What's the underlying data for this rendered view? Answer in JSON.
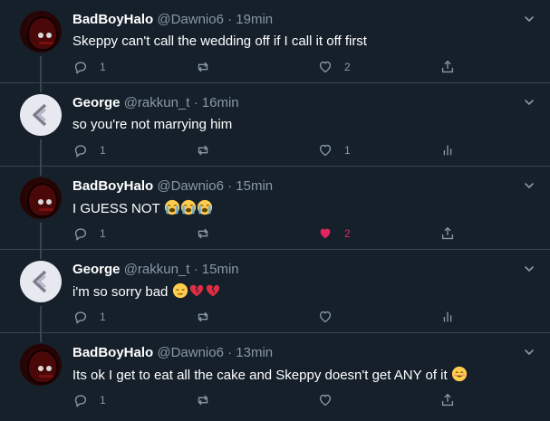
{
  "tweets": [
    {
      "name": "BadBoyHalo",
      "handle": "@Dawnio6",
      "dot": "·",
      "time": "19min",
      "text": "Skeppy can't call the wedding off if I call it off first",
      "emoji": [],
      "replies": "1",
      "retweets": "",
      "likes": "2",
      "liked": false,
      "last_action": "share"
    },
    {
      "name": "George",
      "handle": "@rakkun_t",
      "dot": "·",
      "time": "16min",
      "text": "so you're not marrying him",
      "emoji": [],
      "replies": "1",
      "retweets": "",
      "likes": "1",
      "liked": false,
      "last_action": "analytics"
    },
    {
      "name": "BadBoyHalo",
      "handle": "@Dawnio6",
      "dot": "·",
      "time": "15min",
      "text": "I GUESS NOT",
      "emoji": [
        "loudly-crying-face-emoji",
        "loudly-crying-face-emoji",
        "loudly-crying-face-emoji"
      ],
      "replies": "1",
      "retweets": "",
      "likes": "2",
      "liked": true,
      "last_action": "share"
    },
    {
      "name": "George",
      "handle": "@rakkun_t",
      "dot": "·",
      "time": "15min",
      "text": "i'm so sorry bad",
      "emoji": [
        "relieved-face-emoji",
        "broken-heart-emoji",
        "broken-heart-emoji"
      ],
      "replies": "1",
      "retweets": "",
      "likes": "",
      "liked": false,
      "last_action": "analytics"
    },
    {
      "name": "BadBoyHalo",
      "handle": "@Dawnio6",
      "dot": "·",
      "time": "13min",
      "text": "Its ok I get to eat all the cake and Skeppy doesn't get ANY of it",
      "emoji": [
        "smiling-face-emoji"
      ],
      "replies": "1",
      "retweets": "",
      "likes": "",
      "liked": false,
      "last_action": "share"
    }
  ],
  "colors": {
    "background": "#15202b",
    "divider": "#38444d",
    "secondary_text": "#8899a6",
    "like_active": "#e0245e"
  }
}
